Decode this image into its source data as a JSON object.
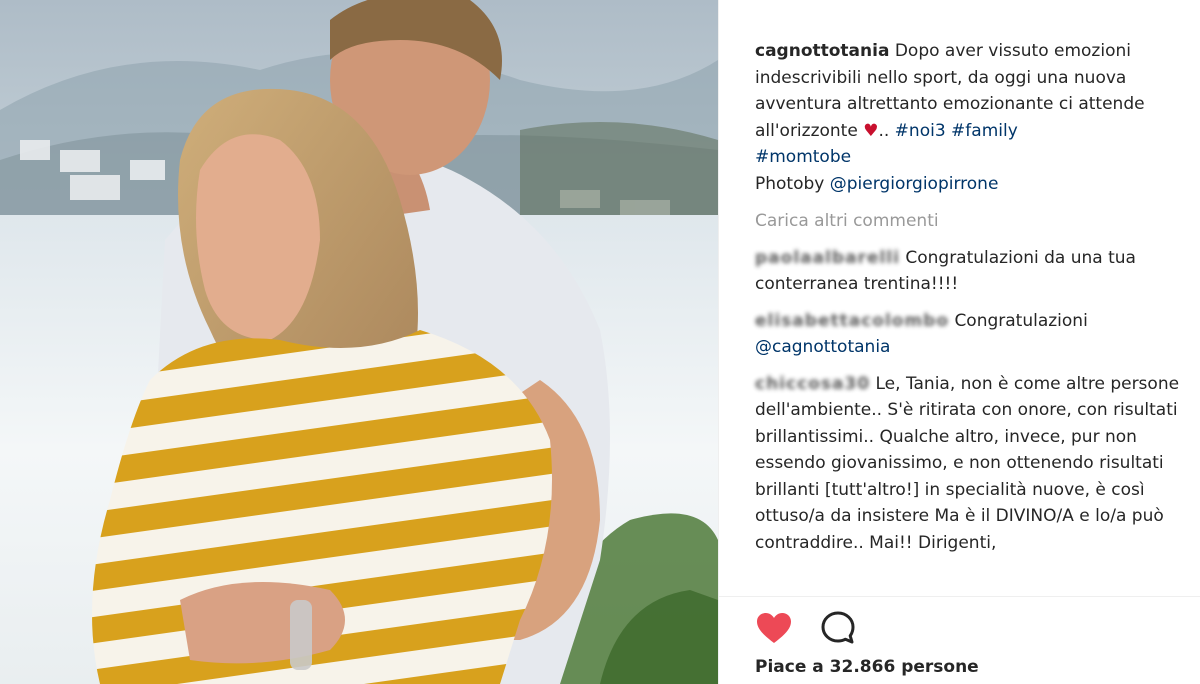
{
  "post": {
    "author": "cagnottotania",
    "caption_text": "Dopo aver vissuto emozioni indescrivibili nello sport, da oggi una nuova avventura altrettanto emozionante ci attende all'orizzonte",
    "caption_heart": "♥",
    "caption_sep": "..",
    "hashtags": [
      "#noi3",
      "#family",
      "#momtobe"
    ],
    "photo_credit_prefix": "Photoby",
    "photo_credit_user": "@piergiorgiopirrone",
    "load_more": "Carica altri commenti"
  },
  "comments": [
    {
      "user": "paolaalbarelli",
      "text": "Congratulazioni da una tua conterranea trentina!!!!"
    },
    {
      "user": "elisabettacolombo",
      "text": "Congratulazioni",
      "mention": "@cagnottotania"
    },
    {
      "user": "chiccosa30",
      "text": "Le, Tania, non è come altre persone dell'ambiente.. S'è ritirata con onore, con risultati brillantissimi.. Qualche altro, invece, pur non essendo giovanissimo, e non ottenendo risultati brillanti [tutt'altro!] in specialità nuove, è così ottuso/a da insistere Ma è il DIVINO/A e lo/a può contraddire.. Mai!! Dirigenti,"
    }
  ],
  "actions": {
    "like_icon": "heart-filled-icon",
    "comment_icon": "comment-bubble-icon",
    "like_color": "#ed4956"
  },
  "likes_text": "Piace a 32.866 persone"
}
